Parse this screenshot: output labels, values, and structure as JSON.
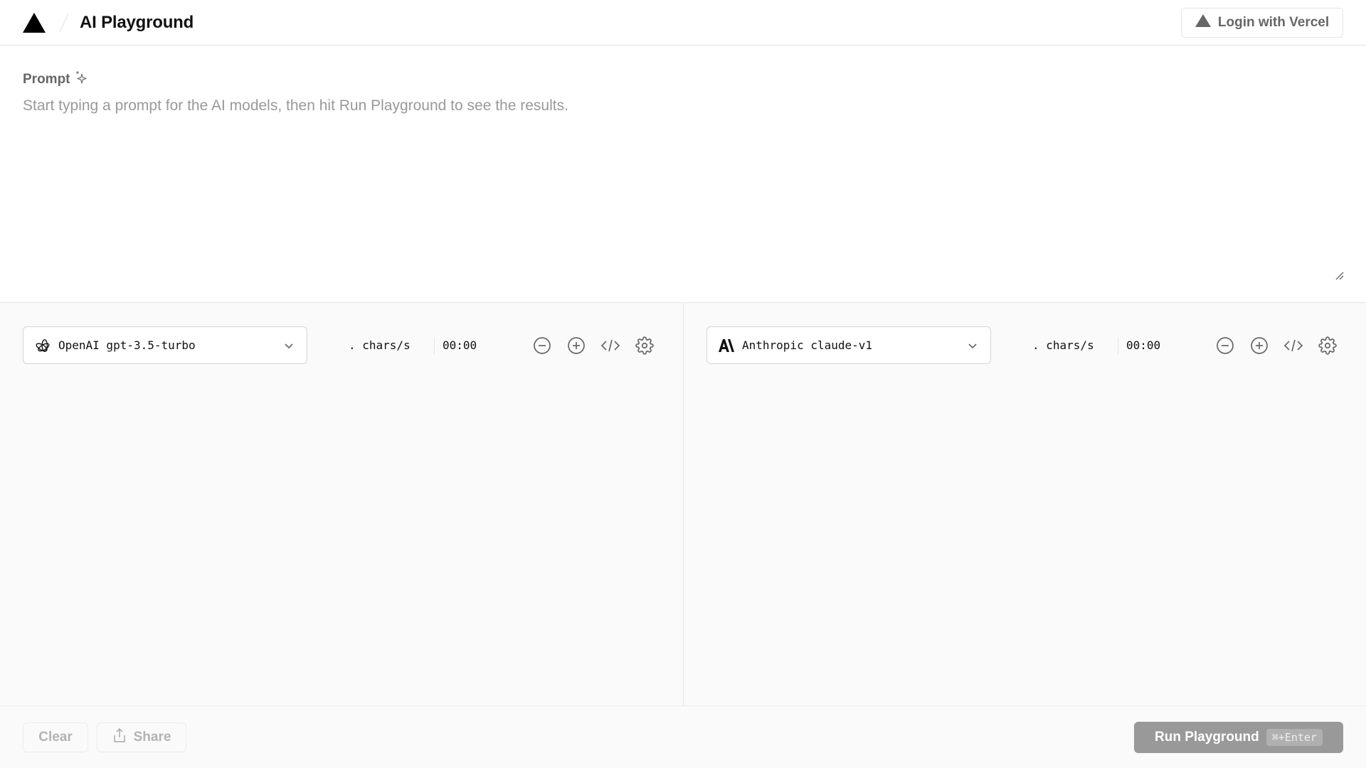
{
  "header": {
    "title": "AI Playground",
    "login_label": "Login with Vercel"
  },
  "prompt": {
    "label": "Prompt",
    "value": "",
    "placeholder": "Start typing a prompt for the AI models, then hit Run Playground to see the results."
  },
  "panels": [
    {
      "provider_icon": "openai-logo-icon",
      "model": "OpenAI gpt-3.5-turbo",
      "rate": ". chars/s",
      "timer": "00:00",
      "output": ""
    },
    {
      "provider_icon": "anthropic-logo-icon",
      "model": "Anthropic claude-v1",
      "rate": ". chars/s",
      "timer": "00:00",
      "output": ""
    }
  ],
  "footer": {
    "clear_label": "Clear",
    "share_label": "Share",
    "run_label": "Run Playground",
    "run_shortcut": "⌘+Enter"
  },
  "colors": {
    "primary_text": "#111111",
    "muted_text": "#666666",
    "border": "#e5e5e5",
    "run_button_disabled": "#999999"
  }
}
